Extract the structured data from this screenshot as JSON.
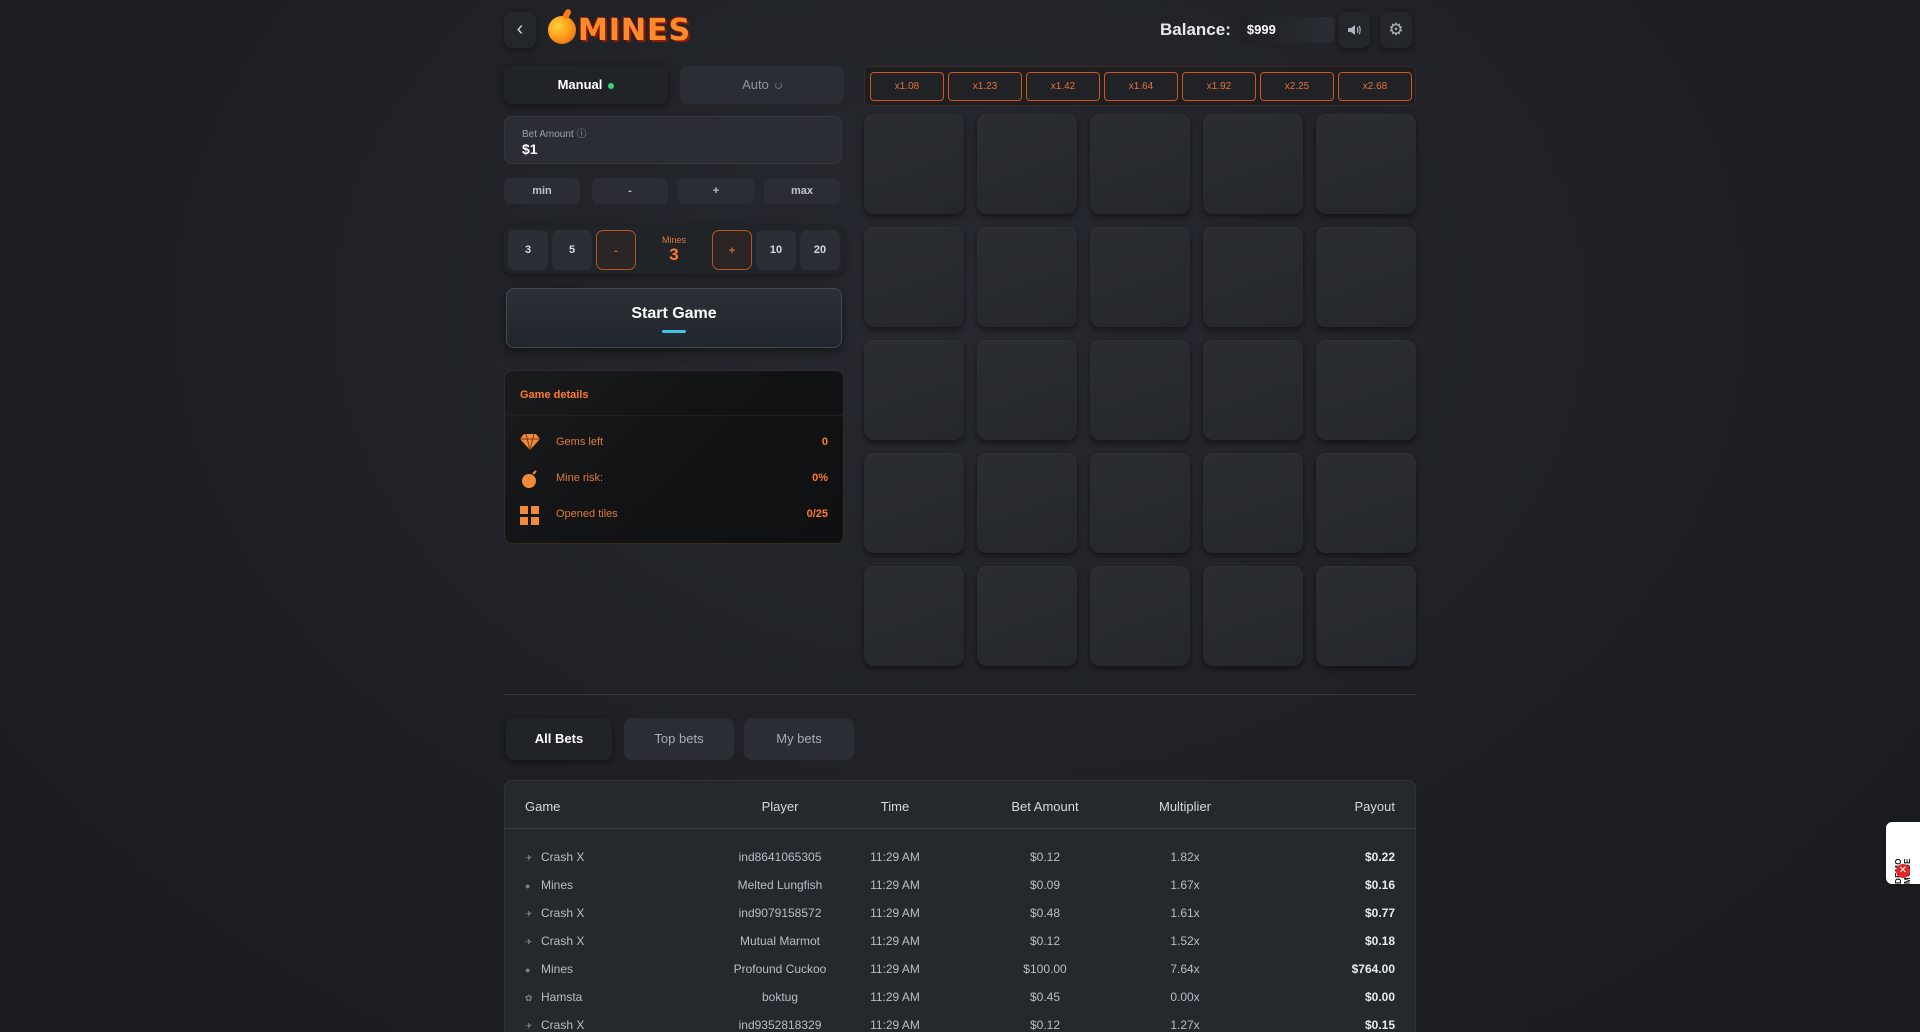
{
  "header": {
    "logo_text": "MINES",
    "balance_label": "Balance:",
    "balance_value": "$999"
  },
  "mode_tabs": [
    {
      "label": "Manual",
      "active": true
    },
    {
      "label": "Auto",
      "active": false
    }
  ],
  "bet": {
    "label": "Bet Amount",
    "value": "$1",
    "adjust": [
      "min",
      "-",
      "+",
      "max"
    ]
  },
  "mines": {
    "presets_left": [
      "3",
      "5"
    ],
    "decrement": "-",
    "label": "Mines",
    "value": "3",
    "increment": "+",
    "presets_right": [
      "10",
      "20"
    ]
  },
  "start_button": "Start Game",
  "game_details": {
    "title": "Game details",
    "rows": [
      {
        "icon": "gem-icon",
        "label": "Gems left",
        "value": "0"
      },
      {
        "icon": "bomb-icon",
        "label": "Mine risk:",
        "value": "0%"
      },
      {
        "icon": "grid-icon",
        "label": "Opened tiles",
        "value": "0/25"
      }
    ]
  },
  "multipliers": [
    "x1.08",
    "x1.23",
    "x1.42",
    "x1.64",
    "x1.92",
    "x2.25",
    "x2.68"
  ],
  "tiles": {
    "rows": 5,
    "cols": 5
  },
  "bets_tabs": [
    {
      "label": "All Bets",
      "active": true
    },
    {
      "label": "Top bets",
      "active": false
    },
    {
      "label": "My bets",
      "active": false
    }
  ],
  "bets_table": {
    "columns": [
      "Game",
      "Player",
      "Time",
      "Bet Amount",
      "Multiplier",
      "Payout"
    ],
    "rows": [
      {
        "icon": "rocket-icon",
        "game": "Crash X",
        "player": "ind8641065305",
        "time": "11:29 AM",
        "bet": "$0.12",
        "mult": "1.82x",
        "payout": "$0.22"
      },
      {
        "icon": "bomb-icon",
        "game": "Mines",
        "player": "Melted Lungfish",
        "time": "11:29 AM",
        "bet": "$0.09",
        "mult": "1.67x",
        "payout": "$0.16"
      },
      {
        "icon": "rocket-icon",
        "game": "Crash X",
        "player": "ind9079158572",
        "time": "11:29 AM",
        "bet": "$0.48",
        "mult": "1.61x",
        "payout": "$0.77"
      },
      {
        "icon": "rocket-icon",
        "game": "Crash X",
        "player": "Mutual Marmot",
        "time": "11:29 AM",
        "bet": "$0.12",
        "mult": "1.52x",
        "payout": "$0.18"
      },
      {
        "icon": "bomb-icon",
        "game": "Mines",
        "player": "Profound Cuckoo",
        "time": "11:29 AM",
        "bet": "$100.00",
        "mult": "7.64x",
        "payout": "$764.00"
      },
      {
        "icon": "hamster-icon",
        "game": "Hamsta",
        "player": "boktug",
        "time": "11:29 AM",
        "bet": "$0.45",
        "mult": "0.00x",
        "payout": "$0.00"
      },
      {
        "icon": "rocket-icon",
        "game": "Crash X",
        "player": "ind9352818329",
        "time": "11:29 AM",
        "bet": "$0.12",
        "mult": "1.27x",
        "payout": "$0.15"
      }
    ]
  },
  "demo_badge": "DEMO MODE",
  "colors": {
    "accent": "#ff7b2d",
    "active_dot": "#3bd16f",
    "start_bar": "#3fc4e8"
  }
}
